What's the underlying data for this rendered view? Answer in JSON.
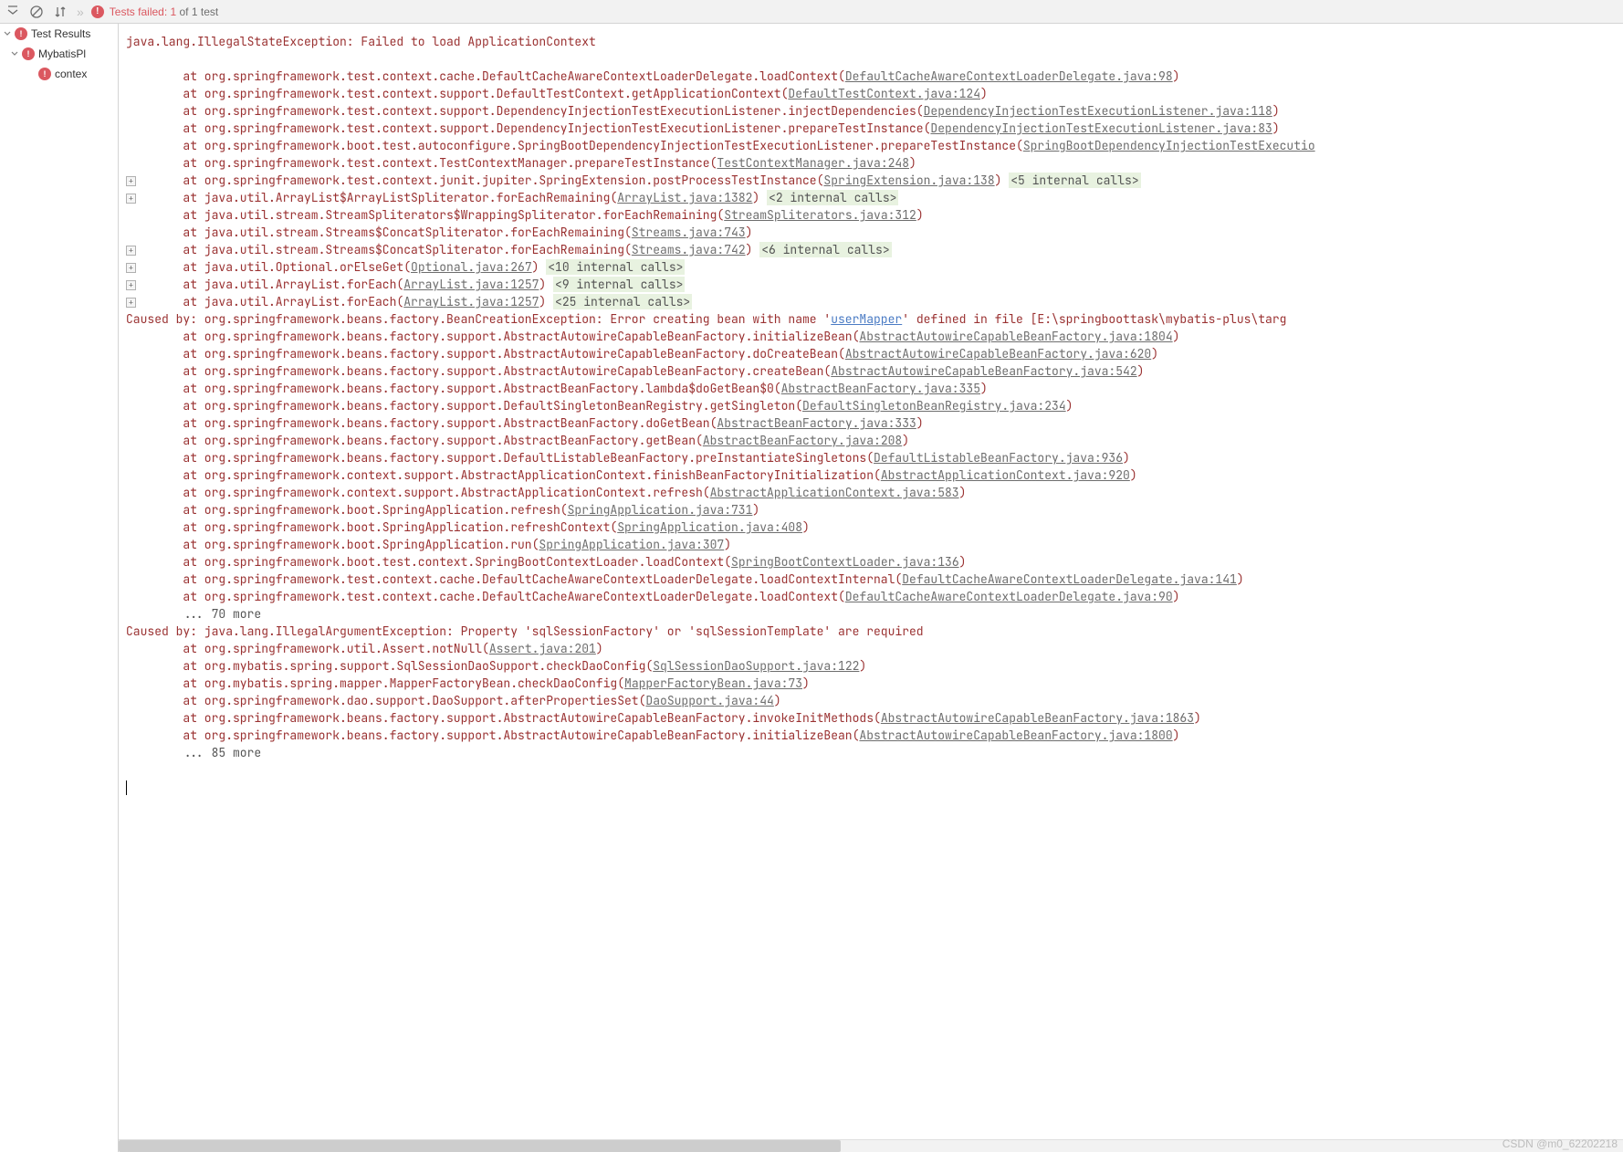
{
  "toolbar": {
    "fail_text": "Tests failed: 1",
    "of_text": " of 1 test"
  },
  "tree": {
    "root": "Test Results",
    "child1": "MybatisPl",
    "child2": "contex"
  },
  "stack": {
    "line0": "java.lang.IllegalStateException: Failed to load ApplicationContext",
    "l1_pre": "\tat org.springframework.test.context.cache.DefaultCacheAwareContextLoaderDelegate.loadContext(",
    "l1_lnk": "DefaultCacheAwareContextLoaderDelegate.java:98",
    "l2_pre": "\tat org.springframework.test.context.support.DefaultTestContext.getApplicationContext(",
    "l2_lnk": "DefaultTestContext.java:124",
    "l3_pre": "\tat org.springframework.test.context.support.DependencyInjectionTestExecutionListener.injectDependencies(",
    "l3_lnk": "DependencyInjectionTestExecutionListener.java:118",
    "l4_pre": "\tat org.springframework.test.context.support.DependencyInjectionTestExecutionListener.prepareTestInstance(",
    "l4_lnk": "DependencyInjectionTestExecutionListener.java:83",
    "l5_pre": "\tat org.springframework.boot.test.autoconfigure.SpringBootDependencyInjectionTestExecutionListener.prepareTestInstance(",
    "l5_lnk": "SpringBootDependencyInjectionTestExecutio",
    "l6_pre": "\tat org.springframework.test.context.TestContextManager.prepareTestInstance(",
    "l6_lnk": "TestContextManager.java:248",
    "l7_pre": "\tat org.springframework.test.context.junit.jupiter.SpringExtension.postProcessTestInstance(",
    "l7_lnk": "SpringExtension.java:138",
    "l7_int": "<5 internal calls>",
    "l8_pre": "\tat java.util.ArrayList$ArrayListSpliterator.forEachRemaining(",
    "l8_lnk": "ArrayList.java:1382",
    "l8_int": "<2 internal calls>",
    "l9_pre": "\tat java.util.stream.StreamSpliterators$WrappingSpliterator.forEachRemaining(",
    "l9_lnk": "StreamSpliterators.java:312",
    "l10_pre": "\tat java.util.stream.Streams$ConcatSpliterator.forEachRemaining(",
    "l10_lnk": "Streams.java:743",
    "l11_pre": "\tat java.util.stream.Streams$ConcatSpliterator.forEachRemaining(",
    "l11_lnk": "Streams.java:742",
    "l11_int": "<6 internal calls>",
    "l12_pre": "\tat java.util.Optional.orElseGet(",
    "l12_lnk": "Optional.java:267",
    "l12_int": "<10 internal calls>",
    "l13_pre": "\tat java.util.ArrayList.forEach(",
    "l13_lnk": "ArrayList.java:1257",
    "l13_int": "<9 internal calls>",
    "l14_pre": "\tat java.util.ArrayList.forEach(",
    "l14_lnk": "ArrayList.java:1257",
    "l14_int": "<25 internal calls>",
    "cause1_pre": "Caused by: org.springframework.beans.factory.BeanCreationException: Error creating bean with name '",
    "cause1_bean": "userMapper",
    "cause1_post": "' defined in file [E:\\springboottask\\mybatis-plus\\targ",
    "c1_pre": "\tat org.springframework.beans.factory.support.AbstractAutowireCapableBeanFactory.initializeBean(",
    "c1_lnk": "AbstractAutowireCapableBeanFactory.java:1804",
    "c2_pre": "\tat org.springframework.beans.factory.support.AbstractAutowireCapableBeanFactory.doCreateBean(",
    "c2_lnk": "AbstractAutowireCapableBeanFactory.java:620",
    "c3_pre": "\tat org.springframework.beans.factory.support.AbstractAutowireCapableBeanFactory.createBean(",
    "c3_lnk": "AbstractAutowireCapableBeanFactory.java:542",
    "c4_pre": "\tat org.springframework.beans.factory.support.AbstractBeanFactory.lambda$doGetBean$0(",
    "c4_lnk": "AbstractBeanFactory.java:335",
    "c5_pre": "\tat org.springframework.beans.factory.support.DefaultSingletonBeanRegistry.getSingleton(",
    "c5_lnk": "DefaultSingletonBeanRegistry.java:234",
    "c6_pre": "\tat org.springframework.beans.factory.support.AbstractBeanFactory.doGetBean(",
    "c6_lnk": "AbstractBeanFactory.java:333",
    "c7_pre": "\tat org.springframework.beans.factory.support.AbstractBeanFactory.getBean(",
    "c7_lnk": "AbstractBeanFactory.java:208",
    "c8_pre": "\tat org.springframework.beans.factory.support.DefaultListableBeanFactory.preInstantiateSingletons(",
    "c8_lnk": "DefaultListableBeanFactory.java:936",
    "c9_pre": "\tat org.springframework.context.support.AbstractApplicationContext.finishBeanFactoryInitialization(",
    "c9_lnk": "AbstractApplicationContext.java:920",
    "c10_pre": "\tat org.springframework.context.support.AbstractApplicationContext.refresh(",
    "c10_lnk": "AbstractApplicationContext.java:583",
    "c11_pre": "\tat org.springframework.boot.SpringApplication.refresh(",
    "c11_lnk": "SpringApplication.java:731",
    "c12_pre": "\tat org.springframework.boot.SpringApplication.refreshContext(",
    "c12_lnk": "SpringApplication.java:408",
    "c13_pre": "\tat org.springframework.boot.SpringApplication.run(",
    "c13_lnk": "SpringApplication.java:307",
    "c14_pre": "\tat org.springframework.boot.test.context.SpringBootContextLoader.loadContext(",
    "c14_lnk": "SpringBootContextLoader.java:136",
    "c15_pre": "\tat org.springframework.test.context.cache.DefaultCacheAwareContextLoaderDelegate.loadContextInternal(",
    "c15_lnk": "DefaultCacheAwareContextLoaderDelegate.java:141",
    "c16_pre": "\tat org.springframework.test.context.cache.DefaultCacheAwareContextLoaderDelegate.loadContext(",
    "c16_lnk": "DefaultCacheAwareContextLoaderDelegate.java:90",
    "more1": "\t... 70 more",
    "cause2": "Caused by: java.lang.IllegalArgumentException: Property 'sqlSessionFactory' or 'sqlSessionTemplate' are required",
    "d1_pre": "\tat org.springframework.util.Assert.notNull(",
    "d1_lnk": "Assert.java:201",
    "d2_pre": "\tat org.mybatis.spring.support.SqlSessionDaoSupport.checkDaoConfig(",
    "d2_lnk": "SqlSessionDaoSupport.java:122",
    "d3_pre": "\tat org.mybatis.spring.mapper.MapperFactoryBean.checkDaoConfig(",
    "d3_lnk": "MapperFactoryBean.java:73",
    "d4_pre": "\tat org.springframework.dao.support.DaoSupport.afterPropertiesSet(",
    "d4_lnk": "DaoSupport.java:44",
    "d5_pre": "\tat org.springframework.beans.factory.support.AbstractAutowireCapableBeanFactory.invokeInitMethods(",
    "d5_lnk": "AbstractAutowireCapableBeanFactory.java:1863",
    "d6_pre": "\tat org.springframework.beans.factory.support.AbstractAutowireCapableBeanFactory.initializeBean(",
    "d6_lnk": "AbstractAutowireCapableBeanFactory.java:1800",
    "more2": "\t... 85 more"
  },
  "watermark": "CSDN @m0_62202218"
}
